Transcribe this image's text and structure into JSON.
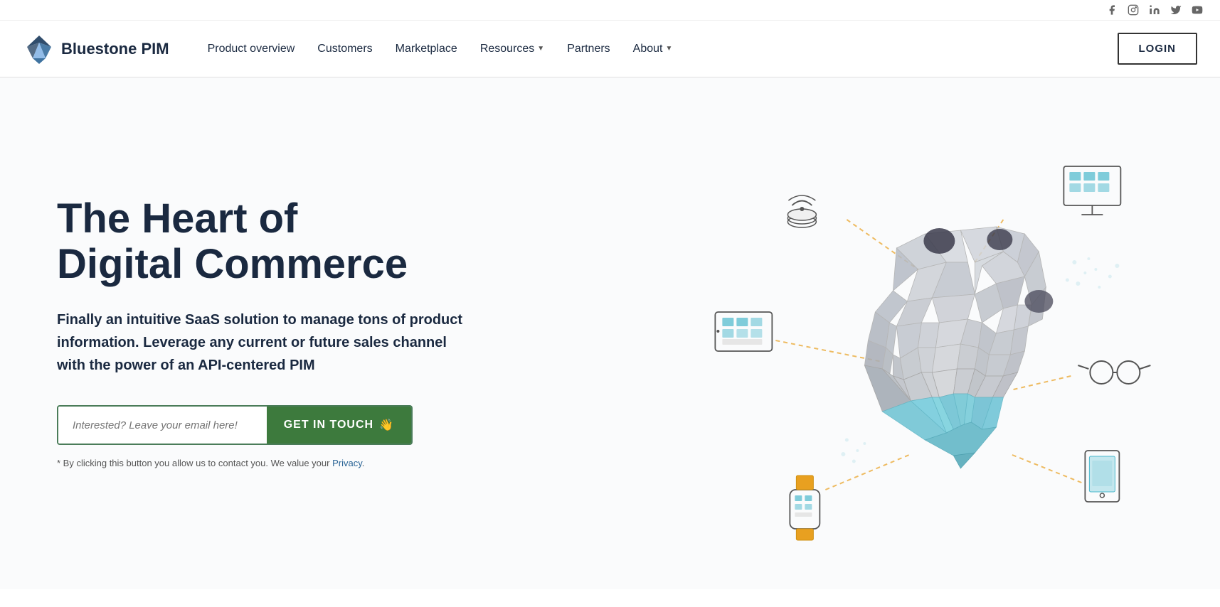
{
  "social": {
    "links": [
      {
        "name": "facebook",
        "icon": "f",
        "url": "#"
      },
      {
        "name": "instagram",
        "icon": "ig",
        "url": "#"
      },
      {
        "name": "linkedin",
        "icon": "in",
        "url": "#"
      },
      {
        "name": "twitter",
        "icon": "tw",
        "url": "#"
      },
      {
        "name": "youtube",
        "icon": "yt",
        "url": "#"
      }
    ]
  },
  "nav": {
    "logo_text": "Bluestone PIM",
    "links": [
      {
        "label": "Product overview",
        "has_dropdown": false
      },
      {
        "label": "Customers",
        "has_dropdown": false
      },
      {
        "label": "Marketplace",
        "has_dropdown": false
      },
      {
        "label": "Resources",
        "has_dropdown": true
      },
      {
        "label": "Partners",
        "has_dropdown": false
      },
      {
        "label": "About",
        "has_dropdown": true
      }
    ],
    "login_label": "LOGIN"
  },
  "hero": {
    "title_line1": "The Heart of",
    "title_line2": "Digital Commerce",
    "subtitle": "Finally an intuitive SaaS solution to manage tons of product information. Leverage any current or future sales channel with the power of an API-centered PIM",
    "input_placeholder": "Interested? Leave your email here!",
    "cta_button": "GET IN TOUCH",
    "cta_emoji": "👋",
    "disclaimer_text": "* By clicking this button you allow us to contact you. We value your",
    "disclaimer_link": "Privacy",
    "disclaimer_end": "."
  }
}
